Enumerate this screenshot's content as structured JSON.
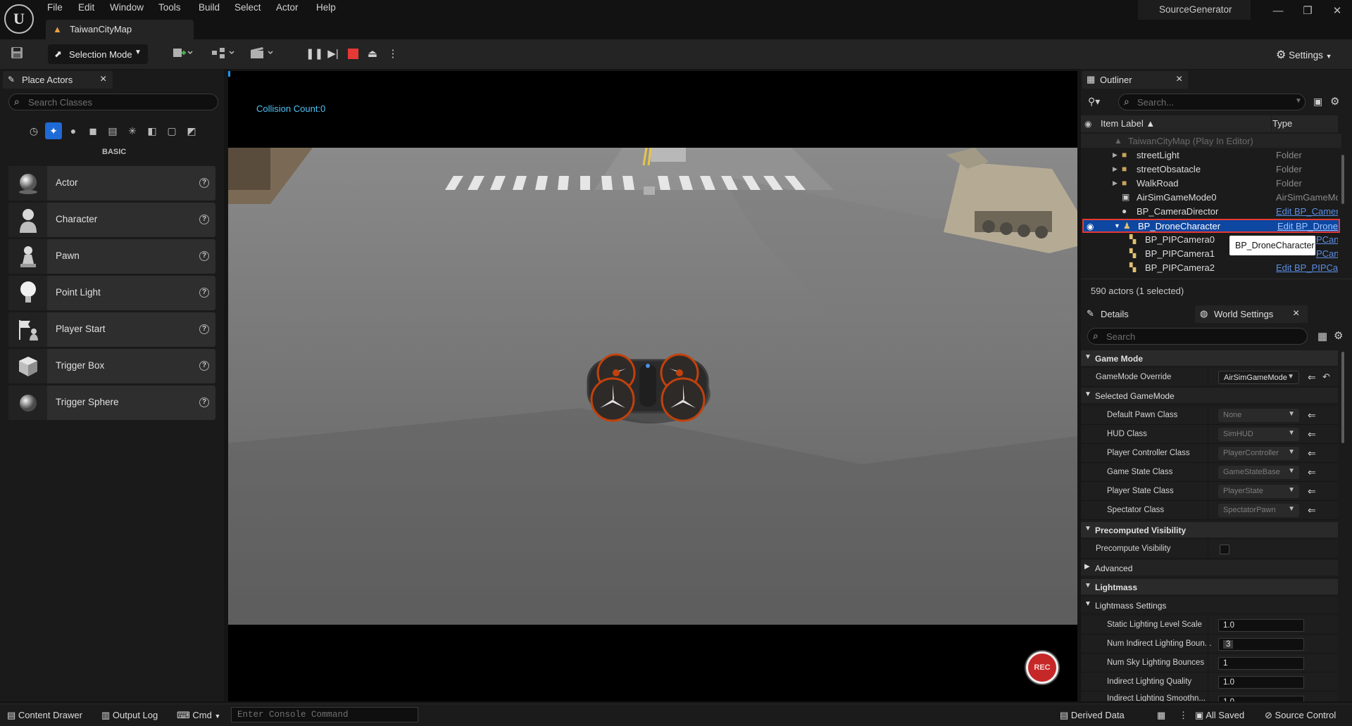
{
  "app": {
    "logo": "U",
    "project_name": "SourceGenerator"
  },
  "menu": [
    "File",
    "Edit",
    "Window",
    "Tools",
    "Build",
    "Select",
    "Actor",
    "Help"
  ],
  "map_tab": {
    "label": "TaiwanCityMap",
    "icon": "warning-icon"
  },
  "window_controls": {
    "minimize": "—",
    "restore": "❐",
    "close": "✕"
  },
  "toolbar": {
    "selection_mode": "Selection Mode",
    "settings": "Settings",
    "play": {
      "pause": "❚❚",
      "frame_advance": "▶|",
      "eject": "⏏",
      "more": "⋮"
    }
  },
  "place_actors": {
    "tab_label": "Place Actors",
    "close": "×",
    "search_placeholder": "Search Classes",
    "category_label": "BASIC",
    "items": [
      {
        "label": "Actor",
        "icon": "sphere-icon"
      },
      {
        "label": "Character",
        "icon": "character-icon"
      },
      {
        "label": "Pawn",
        "icon": "pawn-icon"
      },
      {
        "label": "Point Light",
        "icon": "light-bulb-icon"
      },
      {
        "label": "Player Start",
        "icon": "player-start-icon"
      },
      {
        "label": "Trigger Box",
        "icon": "cube-icon"
      },
      {
        "label": "Trigger Sphere",
        "icon": "sphere-icon"
      }
    ],
    "help": "?"
  },
  "viewport": {
    "collision_text": "Collision Count:0",
    "rec_label": "REC"
  },
  "outliner": {
    "tab_label": "Outliner",
    "close": "×",
    "search_placeholder": "Search...",
    "columns": {
      "label": "Item Label ▲",
      "type": "Type"
    },
    "rows": [
      {
        "label": "TaiwanCityMap (Play In Editor)",
        "type": ""
      },
      {
        "label": "streetLight",
        "type": "Folder"
      },
      {
        "label": "streetObsatacle",
        "type": "Folder"
      },
      {
        "label": "WalkRoad",
        "type": "Folder"
      },
      {
        "label": "AirSimGameMode0",
        "type": "AirSimGameMo"
      },
      {
        "label": "BP_CameraDirector",
        "type": "Edit BP_Camera"
      },
      {
        "label": "BP_DroneCharacter",
        "type": "Edit BP_DroneC"
      },
      {
        "label": "BP_PIPCamera0",
        "type": "PCan"
      },
      {
        "label": "BP_PIPCamera1",
        "type": "PCan"
      },
      {
        "label": "BP_PIPCamera2",
        "type": "Edit BP_PIPCan"
      }
    ],
    "tooltip": "BP_DroneCharacter",
    "count": "590 actors (1 selected)"
  },
  "details": {
    "tab_label": "Details",
    "world_settings_tab": "World Settings",
    "close": "×",
    "search_placeholder": "Search",
    "sections": {
      "game_mode": "Game Mode",
      "selected_game_mode": "Selected GameMode",
      "precomputed_visibility": "Precomputed Visibility",
      "advanced": "Advanced",
      "lightmass": "Lightmass",
      "lightmass_settings": "Lightmass Settings"
    },
    "game_mode_override": {
      "label": "GameMode Override",
      "value": "AirSimGameMode"
    },
    "selected_props": [
      {
        "label": "Default Pawn Class",
        "value": "None"
      },
      {
        "label": "HUD Class",
        "value": "SimHUD"
      },
      {
        "label": "Player Controller Class",
        "value": "PlayerController"
      },
      {
        "label": "Game State Class",
        "value": "GameStateBase"
      },
      {
        "label": "Player State Class",
        "value": "PlayerState"
      },
      {
        "label": "Spectator Class",
        "value": "SpectatorPawn"
      }
    ],
    "precompute_visibility": {
      "label": "Precompute Visibility",
      "checked": false
    },
    "lightmass_props": [
      {
        "label": "Static Lighting Level Scale",
        "value": "1.0"
      },
      {
        "label": "Num Indirect Lighting Boun...",
        "value": "3"
      },
      {
        "label": "Num Sky Lighting Bounces",
        "value": "1"
      },
      {
        "label": "Indirect Lighting Quality",
        "value": "1.0"
      },
      {
        "label": "Indirect Lighting Smoothn...",
        "value": "1.0"
      }
    ]
  },
  "statusbar": {
    "content_drawer": "Content Drawer",
    "output_log": "Output Log",
    "cmd": "Cmd",
    "console_placeholder": "Enter Console Command",
    "derived_data": "Derived Data",
    "all_saved": "All Saved",
    "source_control": "Source Control"
  },
  "colors": {
    "accent": "#0d47a1",
    "stop": "#e53935",
    "link": "#5b8fe6",
    "collision_text": "#4fc3f7"
  }
}
